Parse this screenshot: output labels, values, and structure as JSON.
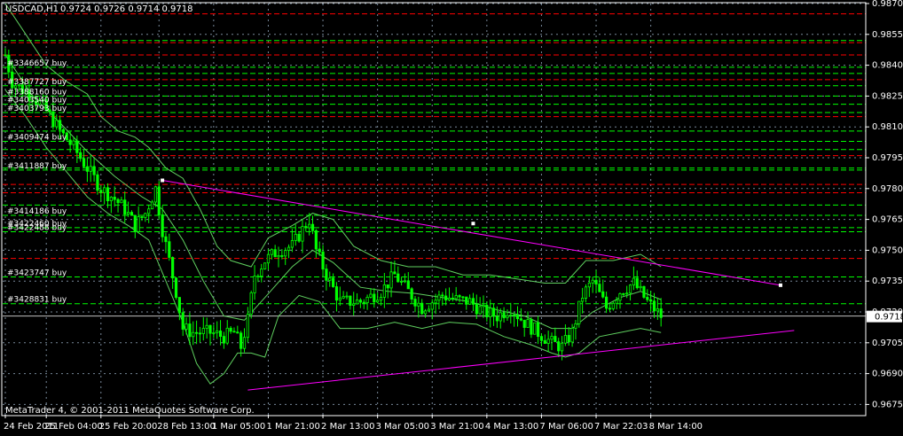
{
  "header": {
    "symbol_label": "USDCAD,H1",
    "ohlc_label": "0.9724 0.9726 0.9714 0.9718"
  },
  "footer": {
    "copyright": "MetaTrader 4, © 2001-2011 MetaQuotes Software Corp."
  },
  "colors": {
    "background": "#000000",
    "frame": "#ffffff",
    "grid": "#778899",
    "candle": "#00ff00",
    "bollinger": "#5fcf5f",
    "trendline": "#ff00ff",
    "buy_level": "#00ff00",
    "stop_level": "#ff0000",
    "current_price_line": "#c0c0c0",
    "text": "#ffffff"
  },
  "chart_data": {
    "type": "candlestick",
    "symbol": "USDCAD",
    "timeframe": "H1",
    "ylim": [
      0.967,
      0.987
    ],
    "grid": true,
    "y_ticks": [
      "0.9870",
      "0.9855",
      "0.9840",
      "0.9825",
      "0.9810",
      "0.9795",
      "0.9780",
      "0.9765",
      "0.9750",
      "0.9735",
      "0.9720",
      "0.9705",
      "0.9690",
      "0.9675"
    ],
    "x_ticks": [
      {
        "label": "24 Feb 2011",
        "i": 0
      },
      {
        "label": "25 Feb 04:00",
        "i": 12
      },
      {
        "label": "25 Feb 20:00",
        "i": 28
      },
      {
        "label": "28 Feb 13:00",
        "i": 45
      },
      {
        "label": "1 Mar 05:00",
        "i": 61
      },
      {
        "label": "1 Mar 21:00",
        "i": 77
      },
      {
        "label": "2 Mar 13:00",
        "i": 93
      },
      {
        "label": "3 Mar 05:00",
        "i": 109
      },
      {
        "label": "3 Mar 21:00",
        "i": 125
      },
      {
        "label": "4 Mar 13:00",
        "i": 141
      },
      {
        "label": "7 Mar 06:00",
        "i": 157
      },
      {
        "label": "7 Mar 22:03",
        "i": 173
      },
      {
        "label": "8 Mar 14:00",
        "i": 189
      }
    ],
    "current_price": "0.9718",
    "bar_count": 193,
    "path_points": [
      [
        0,
        0.9845
      ],
      [
        2,
        0.9832
      ],
      [
        5,
        0.9828
      ],
      [
        8,
        0.9825
      ],
      [
        12,
        0.9818
      ],
      [
        16,
        0.9808
      ],
      [
        20,
        0.98
      ],
      [
        24,
        0.979
      ],
      [
        28,
        0.978
      ],
      [
        32,
        0.9775
      ],
      [
        35,
        0.977
      ],
      [
        38,
        0.9762
      ],
      [
        41,
        0.9768
      ],
      [
        44,
        0.978
      ],
      [
        46,
        0.976
      ],
      [
        48,
        0.9745
      ],
      [
        50,
        0.973
      ],
      [
        52,
        0.9712
      ],
      [
        55,
        0.971
      ],
      [
        60,
        0.971
      ],
      [
        64,
        0.9708
      ],
      [
        67,
        0.971
      ],
      [
        69,
        0.9703
      ],
      [
        71,
        0.9716
      ],
      [
        73,
        0.9738
      ],
      [
        76,
        0.9745
      ],
      [
        80,
        0.975
      ],
      [
        84,
        0.9752
      ],
      [
        87,
        0.976
      ],
      [
        89,
        0.9765
      ],
      [
        91,
        0.975
      ],
      [
        94,
        0.9738
      ],
      [
        98,
        0.9725
      ],
      [
        104,
        0.9725
      ],
      [
        110,
        0.973
      ],
      [
        114,
        0.9738
      ],
      [
        118,
        0.973
      ],
      [
        122,
        0.9722
      ],
      [
        128,
        0.9728
      ],
      [
        132,
        0.9726
      ],
      [
        136,
        0.9725
      ],
      [
        140,
        0.972
      ],
      [
        144,
        0.9718
      ],
      [
        148,
        0.9722
      ],
      [
        152,
        0.9715
      ],
      [
        156,
        0.971
      ],
      [
        160,
        0.9705
      ],
      [
        163,
        0.9703
      ],
      [
        166,
        0.971
      ],
      [
        169,
        0.9728
      ],
      [
        172,
        0.9735
      ],
      [
        176,
        0.9722
      ],
      [
        180,
        0.973
      ],
      [
        184,
        0.9734
      ],
      [
        188,
        0.9725
      ],
      [
        192,
        0.9718
      ]
    ],
    "bollinger_bands": {
      "upper": [
        [
          0,
          0.987
        ],
        [
          6,
          0.9855
        ],
        [
          12,
          0.984
        ],
        [
          18,
          0.9832
        ],
        [
          24,
          0.9826
        ],
        [
          28,
          0.9815
        ],
        [
          33,
          0.9808
        ],
        [
          38,
          0.9805
        ],
        [
          42,
          0.98
        ],
        [
          47,
          0.979
        ],
        [
          52,
          0.9785
        ],
        [
          57,
          0.977
        ],
        [
          62,
          0.9752
        ],
        [
          66,
          0.9745
        ],
        [
          72,
          0.9742
        ],
        [
          77,
          0.9756
        ],
        [
          84,
          0.9762
        ],
        [
          90,
          0.9768
        ],
        [
          96,
          0.9765
        ],
        [
          102,
          0.9752
        ],
        [
          110,
          0.9745
        ],
        [
          118,
          0.9742
        ],
        [
          126,
          0.9742
        ],
        [
          134,
          0.9738
        ],
        [
          142,
          0.9738
        ],
        [
          150,
          0.9736
        ],
        [
          158,
          0.9734
        ],
        [
          164,
          0.9734
        ],
        [
          170,
          0.9745
        ],
        [
          178,
          0.9745
        ],
        [
          186,
          0.9748
        ],
        [
          192,
          0.9742
        ]
      ],
      "middle": [
        [
          0,
          0.9845
        ],
        [
          8,
          0.9825
        ],
        [
          16,
          0.9812
        ],
        [
          24,
          0.9798
        ],
        [
          32,
          0.9786
        ],
        [
          40,
          0.9776
        ],
        [
          46,
          0.977
        ],
        [
          52,
          0.9755
        ],
        [
          58,
          0.9735
        ],
        [
          64,
          0.9718
        ],
        [
          70,
          0.9716
        ],
        [
          76,
          0.9727
        ],
        [
          84,
          0.9742
        ],
        [
          90,
          0.975
        ],
        [
          96,
          0.9744
        ],
        [
          104,
          0.9732
        ],
        [
          112,
          0.973
        ],
        [
          120,
          0.9729
        ],
        [
          128,
          0.9727
        ],
        [
          136,
          0.9725
        ],
        [
          144,
          0.9721
        ],
        [
          152,
          0.9718
        ],
        [
          160,
          0.9712
        ],
        [
          166,
          0.9712
        ],
        [
          172,
          0.972
        ],
        [
          180,
          0.9727
        ],
        [
          186,
          0.973
        ],
        [
          192,
          0.9726
        ]
      ],
      "lower": [
        [
          0,
          0.9828
        ],
        [
          6,
          0.9815
        ],
        [
          12,
          0.98
        ],
        [
          18,
          0.9788
        ],
        [
          24,
          0.9776
        ],
        [
          30,
          0.9768
        ],
        [
          36,
          0.9762
        ],
        [
          42,
          0.9755
        ],
        [
          47,
          0.9735
        ],
        [
          52,
          0.9715
        ],
        [
          56,
          0.9695
        ],
        [
          60,
          0.9685
        ],
        [
          64,
          0.969
        ],
        [
          68,
          0.97
        ],
        [
          72,
          0.97
        ],
        [
          76,
          0.9698
        ],
        [
          80,
          0.9718
        ],
        [
          86,
          0.9728
        ],
        [
          92,
          0.9725
        ],
        [
          98,
          0.9712
        ],
        [
          106,
          0.9712
        ],
        [
          114,
          0.9715
        ],
        [
          122,
          0.9712
        ],
        [
          130,
          0.9715
        ],
        [
          138,
          0.9714
        ],
        [
          146,
          0.9708
        ],
        [
          154,
          0.9704
        ],
        [
          160,
          0.97
        ],
        [
          164,
          0.9698
        ],
        [
          168,
          0.97
        ],
        [
          174,
          0.9708
        ],
        [
          180,
          0.971
        ],
        [
          186,
          0.9712
        ],
        [
          192,
          0.971
        ]
      ]
    },
    "trendlines": [
      {
        "name": "upper-trendline",
        "p1": [
          46,
          0.9784
        ],
        "p2": [
          227,
          0.9733
        ],
        "anchors": [
          [
            46,
            0.9784
          ],
          [
            137,
            0.9763
          ],
          [
            227,
            0.9733
          ]
        ]
      },
      {
        "name": "lower-trendline",
        "p1": [
          71,
          0.9682
        ],
        "p2": [
          231,
          0.9711
        ],
        "anchors": []
      }
    ],
    "order_levels": [
      {
        "label": "#3346657 buy",
        "price": 0.9839,
        "kind": "buy"
      },
      {
        "label": "#3387727 buy",
        "price": 0.983,
        "kind": "buy"
      },
      {
        "label": "#3388160 buy",
        "price": 0.9825,
        "kind": "buy"
      },
      {
        "label": "#3403540 buy",
        "price": 0.9821,
        "kind": "buy"
      },
      {
        "label": "#3403793 buy",
        "price": 0.9817,
        "kind": "buy"
      },
      {
        "label": "#3409474 buy",
        "price": 0.9803,
        "kind": "buy"
      },
      {
        "label": "#3411887 buy",
        "price": 0.9789,
        "kind": "buy"
      },
      {
        "label": "#3414186 buy",
        "price": 0.9767,
        "kind": "buy"
      },
      {
        "label": "#3422460 buy",
        "price": 0.9761,
        "kind": "buy"
      },
      {
        "label": "#3422488 buy",
        "price": 0.9759,
        "kind": "buy"
      },
      {
        "label": "#3423747 buy",
        "price": 0.9737,
        "kind": "buy"
      },
      {
        "label": "#3428831 buy",
        "price": 0.9724,
        "kind": "buy"
      }
    ],
    "stop_levels": [
      0.9865,
      0.9851,
      0.9845,
      0.9833,
      0.9815,
      0.9796,
      0.9782,
      0.9778,
      0.9746
    ],
    "extra_buy_levels": [
      0.9852,
      0.9836,
      0.9808,
      0.9799,
      0.979,
      0.9772
    ]
  }
}
